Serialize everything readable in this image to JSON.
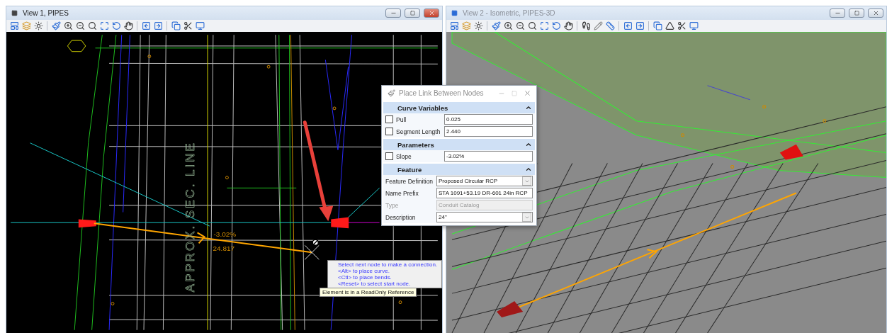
{
  "views": [
    {
      "title": "View 1, PIPES",
      "active": true,
      "labels": [
        {
          "kind": "section-line",
          "text": "APPROX. SEC. LINE"
        },
        {
          "kind": "slope",
          "text": "-3.02%"
        },
        {
          "kind": "length",
          "text": "24.817"
        }
      ]
    },
    {
      "title": "View 2 - Isometric, PIPES-3D",
      "active": false
    }
  ],
  "dialog": {
    "title": "Place Link Between Nodes",
    "sections": [
      {
        "title": "Curve Variables",
        "expanded": true,
        "rows": [
          {
            "kind": "check",
            "label": "Pull",
            "checked": false,
            "value": "0.025"
          },
          {
            "kind": "check",
            "label": "Segment Length",
            "checked": false,
            "value": "2.440"
          }
        ]
      },
      {
        "title": "Parameters",
        "expanded": true,
        "rows": [
          {
            "kind": "check",
            "label": "Slope",
            "checked": false,
            "value": "-3.02%"
          }
        ]
      },
      {
        "title": "Feature",
        "expanded": true,
        "rows": [
          {
            "kind": "dropdown",
            "label": "Feature Definition",
            "value": "Proposed Circular RCP",
            "disabled": false
          },
          {
            "kind": "text",
            "label": "Name Prefix",
            "value": "STA 1091+53.19 DR-601 24in RCP",
            "disabled": false
          },
          {
            "kind": "text",
            "label": "Type",
            "value": "Conduit Catalog",
            "disabled": true
          },
          {
            "kind": "dropdown",
            "label": "Description",
            "value": "24\"",
            "disabled": false
          }
        ]
      }
    ]
  },
  "prompt": {
    "lines": [
      "Select next node to make a connection.",
      "<Alt> to place curve.",
      "<Ctl> to place bends.",
      "<Reset> to select start node."
    ]
  },
  "status_tip": "Element is in a ReadOnly Reference"
}
